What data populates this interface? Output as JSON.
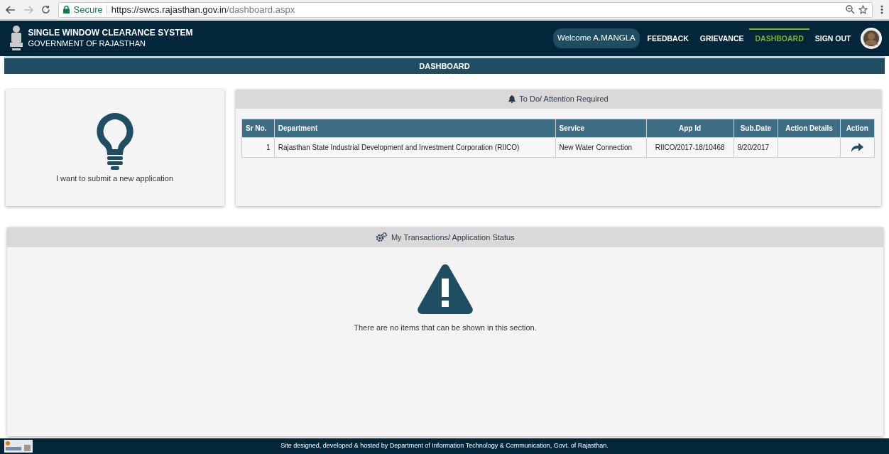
{
  "browser": {
    "secure_label": "Secure",
    "url_host": "https://swcs.rajasthan.gov.in",
    "url_path": "/dashboard.aspx"
  },
  "header": {
    "title": "SINGLE WINDOW CLEARANCE SYSTEM",
    "subtitle": "GOVERNMENT OF RAJASTHAN",
    "welcome": "Welcome A.MANGLA",
    "nav": [
      {
        "label": "FEEDBACK",
        "selected": false
      },
      {
        "label": "GRIEVANCE",
        "selected": false
      },
      {
        "label": "DASHBOARD",
        "selected": true
      },
      {
        "label": "SIGN OUT",
        "selected": false
      }
    ]
  },
  "page_title": "DASHBOARD",
  "new_application": {
    "label": "I want to submit a new application"
  },
  "todo": {
    "title": "To Do/ Attention Required",
    "columns": [
      "Sr No.",
      "Department",
      "Service",
      "App Id",
      "Sub.Date",
      "Action Details",
      "Action"
    ],
    "rows": [
      {
        "sr_no": "1",
        "department": "Rajasthan State Industrial Development and Investment Corporation (RIICO)",
        "service": "New Water Connection",
        "app_id": "RIICO/2017-18/10468",
        "sub_date": "9/20/2017"
      }
    ]
  },
  "transactions": {
    "title": "My Transactions/ Application Status",
    "empty_message": "There are no items that can be shown in this section."
  },
  "footer": "Site designed, developed & hosted by Department of Information Technology & Communication, Govt. of Rajasthan."
}
